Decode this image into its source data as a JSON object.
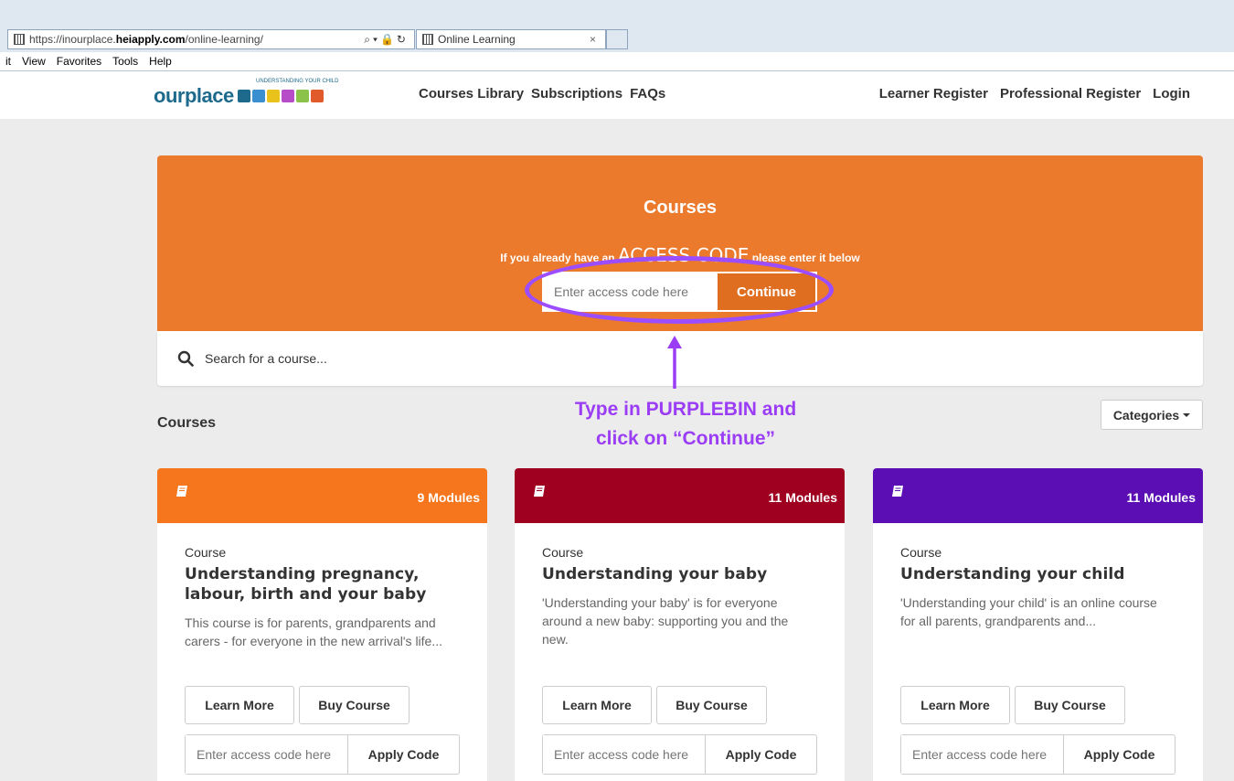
{
  "browser": {
    "url_prefix": "https://inourplace.",
    "url_host": "heiapply.com",
    "url_path": "/online-learning/",
    "tab_title": "Online Learning",
    "menu": [
      "it",
      "View",
      "Favorites",
      "Tools",
      "Help"
    ]
  },
  "site": {
    "logo_text": "ourplace",
    "logo_tagline": "UNDERSTANDING YOUR CHILD",
    "nav_left": [
      "Courses Library",
      "Subscriptions",
      "FAQs"
    ],
    "nav_right": [
      "Learner Register",
      "Professional Register",
      "Login"
    ]
  },
  "hero": {
    "title": "Courses",
    "sub_before": "If you already have an ",
    "sub_highlight": "ACCESS CODE",
    "sub_after": " please enter it below",
    "input_placeholder": "Enter access code here",
    "button_label": "Continue",
    "bg_color": "#ec7a2c"
  },
  "search": {
    "placeholder": "Search for a course..."
  },
  "annotation": {
    "line1": "Type in PURPLEBIN and",
    "line2": "click on “Continue”",
    "color": "#9b3df5"
  },
  "section": {
    "title": "Courses",
    "categories_label": "Categories"
  },
  "courses": [
    {
      "color": "#f5761c",
      "modules": "9 Modules",
      "kind": "Course",
      "title": "Understanding pregnancy, labour, birth and your baby",
      "description": "This course is for parents, grandparents and carers - for everyone in the new arrival's life...",
      "learn_more": "Learn More",
      "buy": "Buy Course",
      "code_placeholder": "Enter access code here",
      "apply": "Apply Code"
    },
    {
      "color": "#a00020",
      "modules": "11 Modules",
      "kind": "Course",
      "title": "Understanding your baby",
      "description": "'Understanding your baby' is for everyone around a new baby: supporting you and the new.",
      "learn_more": "Learn More",
      "buy": "Buy Course",
      "code_placeholder": "Enter access code here",
      "apply": "Apply Code"
    },
    {
      "color": "#5a0eb4",
      "modules": "11 Modules",
      "kind": "Course",
      "title": "Understanding your child",
      "description": "'Understanding your child' is an online course for all parents, grandparents and...",
      "learn_more": "Learn More",
      "buy": "Buy Course",
      "code_placeholder": "Enter access code here",
      "apply": "Apply Code"
    }
  ]
}
